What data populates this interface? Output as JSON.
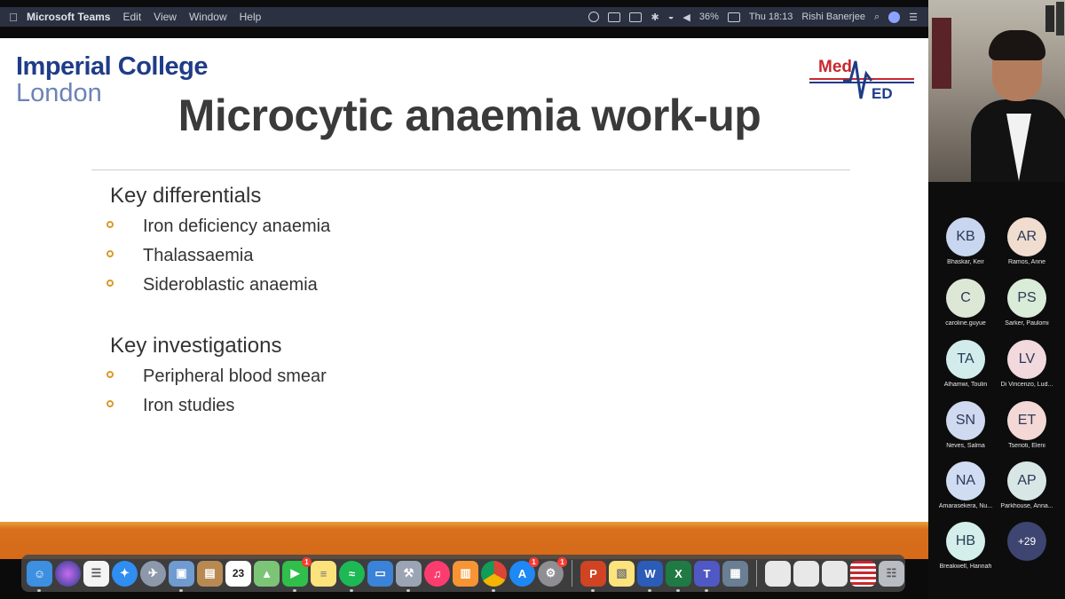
{
  "menubar": {
    "app_name": "Microsoft Teams",
    "menus": [
      "Edit",
      "View",
      "Window",
      "Help"
    ],
    "battery": "36%",
    "clock": "Thu 18:13",
    "user": "Rishi Banerjee"
  },
  "slide": {
    "logo_line1": "Imperial College",
    "logo_line2": "London",
    "logo_meded_top": "Med",
    "logo_meded_bottom": "ED",
    "title": "Microcytic anaemia work-up",
    "section1_heading": "Key differentials",
    "section1_items": [
      "Iron deficiency anaemia",
      "Thalassaemia",
      "Sideroblastic anaemia"
    ],
    "section2_heading": "Key investigations",
    "section2_items": [
      "Peripheral blood smear",
      "Iron studies"
    ],
    "bullet_color": "#d99a2b",
    "footer_color": "#d8701c"
  },
  "participants": [
    {
      "initials": "KB",
      "name": "Bhaskar, Keir",
      "color": "#c9d6ef"
    },
    {
      "initials": "AR",
      "name": "Ramos, Anne",
      "color": "#f0ddd0"
    },
    {
      "initials": "C",
      "name": "caroline.guyue",
      "color": "#dde7d6"
    },
    {
      "initials": "PS",
      "name": "Sarker, Paulomi",
      "color": "#d9ecd8"
    },
    {
      "initials": "TA",
      "name": "Alhamwi, Toulin",
      "color": "#d2ecec"
    },
    {
      "initials": "LV",
      "name": "Di Vincenzo, Lud...",
      "color": "#f1d9dd"
    },
    {
      "initials": "SN",
      "name": "Neves, Salma",
      "color": "#cfd9ef"
    },
    {
      "initials": "ET",
      "name": "Tserioti, Eleni",
      "color": "#f3d8d6"
    },
    {
      "initials": "NA",
      "name": "Amarasekera, Nu...",
      "color": "#cfdcf1"
    },
    {
      "initials": "AP",
      "name": "Parkhouse, Anna...",
      "color": "#d8e6e6"
    },
    {
      "initials": "HB",
      "name": "Breakwell, Hannah",
      "color": "#d3eeeb"
    }
  ],
  "more_count": "+29",
  "dock": {
    "calendar_day": "23",
    "badge_facetime": "1",
    "badge_chrome": "1",
    "badge_settings": "1"
  }
}
